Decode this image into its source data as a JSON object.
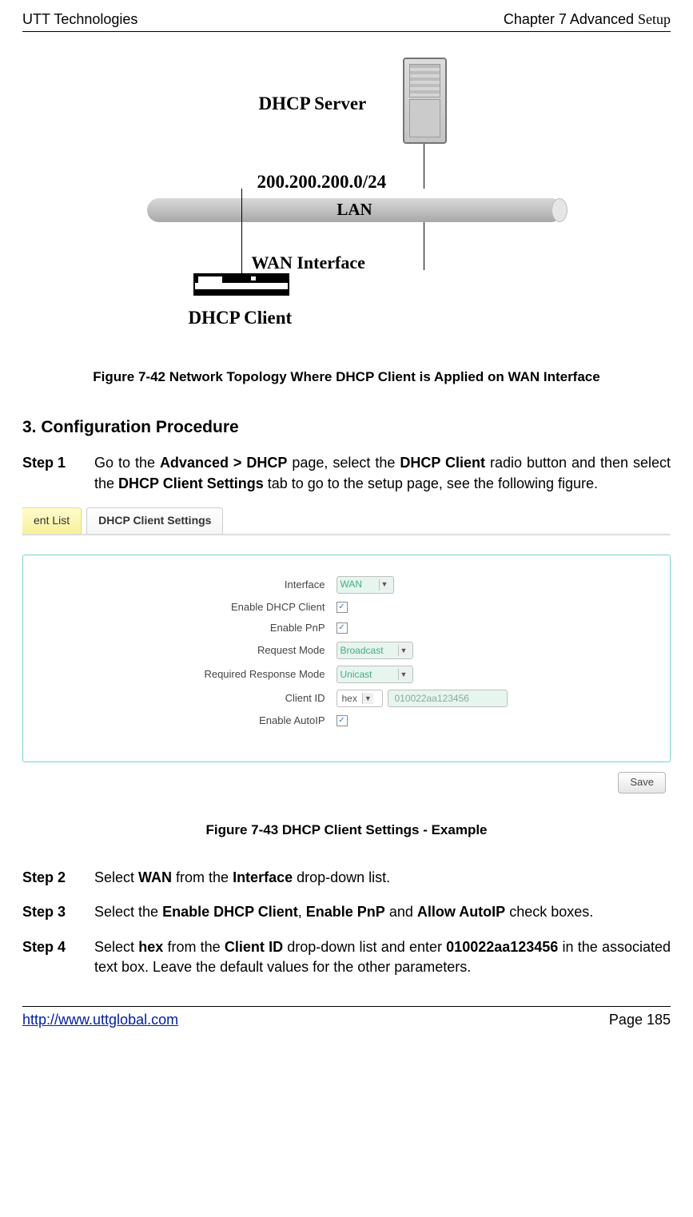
{
  "header": {
    "vendor": "UTT Technologies",
    "chapter": "Chapter 7 Advanced ",
    "chapter_suffix": "Setup"
  },
  "diagram": {
    "dhcp_server": "DHCP Server",
    "subnet": "200.200.200.0/24",
    "lan": "LAN",
    "wan": "WAN Interface",
    "dhcp_client": "DHCP Client"
  },
  "captions": {
    "fig_42": "Figure 7-42 Network Topology Where DHCP Client is Applied on WAN Interface",
    "fig_43": "Figure 7-43 DHCP Client Settings - Example"
  },
  "section_title": "3.   Configuration Procedure",
  "steps": {
    "s1_num": "Step 1",
    "s1_t1": "Go to the ",
    "s1_b1": "Advanced > DHCP",
    "s1_t2": " page, select the ",
    "s1_b2": "DHCP Client",
    "s1_t3": " radio button and then select the ",
    "s1_b3": "DHCP Client Settings",
    "s1_t4": " tab to go to the setup page, see the following figure.",
    "s2_num": "Step 2",
    "s2_t1": "Select ",
    "s2_b1": "WAN",
    "s2_t2": " from the ",
    "s2_b2": "Interface",
    "s2_t3": " drop-down list.",
    "s3_num": "Step 3",
    "s3_t1": "Select the ",
    "s3_b1": "Enable DHCP Client",
    "s3_t2": ", ",
    "s3_b2": "Enable PnP",
    "s3_t3": " and ",
    "s3_b3": "Allow AutoIP",
    "s3_t4": " check boxes.",
    "s4_num": "Step 4",
    "s4_t1": "Select ",
    "s4_b1": "hex",
    "s4_t2": " from the ",
    "s4_b2": "Client ID",
    "s4_t3": " drop-down list and enter ",
    "s4_b3": "010022aa123456",
    "s4_t4": " in the associated text box. Leave the default values for the other parameters."
  },
  "tabs": {
    "left_partial": "ent List",
    "active": "DHCP Client Settings"
  },
  "form": {
    "interface_lbl": "Interface",
    "interface_val": "WAN",
    "enable_client_lbl": "Enable DHCP Client",
    "enable_pnp_lbl": "Enable PnP",
    "request_mode_lbl": "Request Mode",
    "request_mode_val": "Broadcast",
    "response_mode_lbl": "Required Response Mode",
    "response_mode_val": "Unicast",
    "client_id_lbl": "Client ID",
    "client_id_type": "hex",
    "client_id_val": "010022aa123456",
    "enable_autoip_lbl": "Enable AutoIP",
    "save_btn": "Save",
    "check_true": "✓"
  },
  "footer": {
    "url": "http://www.uttglobal.com",
    "page": "Page 185"
  }
}
